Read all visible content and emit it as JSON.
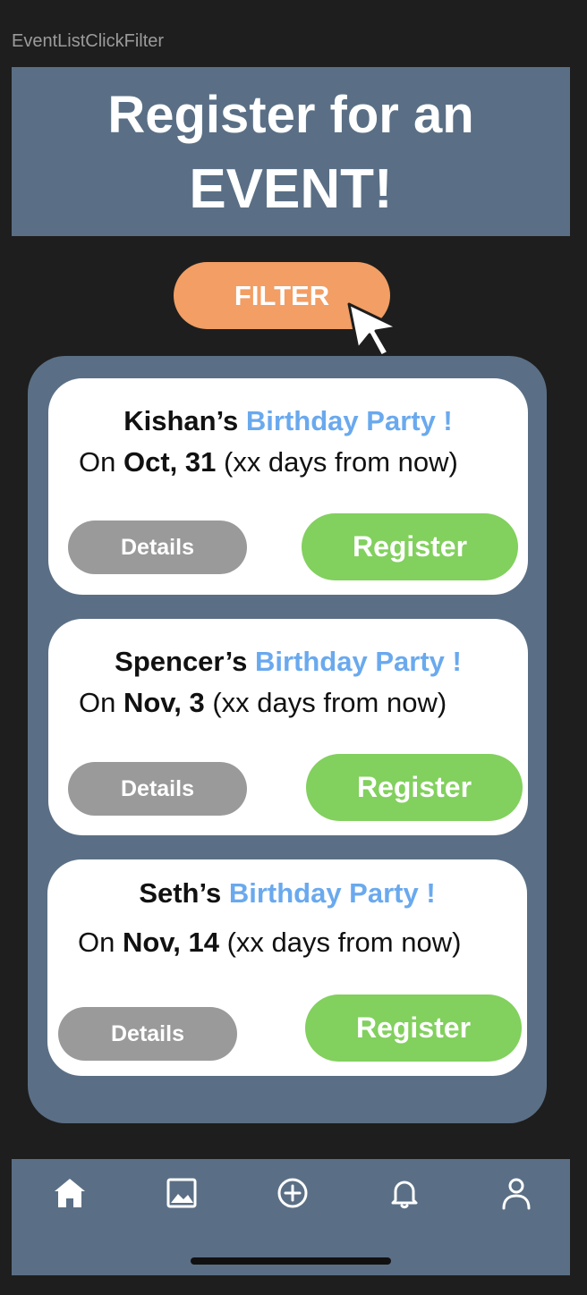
{
  "frame_label": "EventListClickFilter",
  "header": {
    "line1": "Register for an",
    "line2": "EVENT!"
  },
  "filter": {
    "label": "FILTER"
  },
  "events": [
    {
      "host": "Kishan’s",
      "accent": "Birthday Party !",
      "prefix": "On",
      "date": "Oct, 31",
      "suffix": "(xx days from now)",
      "details_label": "Details",
      "register_label": "Register"
    },
    {
      "host": "Spencer’s",
      "accent": "Birthday Party !",
      "prefix": "On",
      "date": "Nov, 3",
      "suffix": "(xx days from now)",
      "details_label": "Details",
      "register_label": "Register"
    },
    {
      "host": "Seth’s",
      "accent": "Birthday Party !",
      "prefix": "On",
      "date": "Nov, 14",
      "suffix": "(xx days from now)",
      "details_label": "Details",
      "register_label": "Register"
    }
  ],
  "nav": {
    "items": [
      {
        "icon": "home-icon"
      },
      {
        "icon": "image-icon"
      },
      {
        "icon": "plus-circle-icon"
      },
      {
        "icon": "bell-icon"
      },
      {
        "icon": "user-icon"
      }
    ]
  },
  "colors": {
    "background": "#1e1e1e",
    "panel": "#5a6f85",
    "filter": "#f29e64",
    "register": "#82d05e",
    "details": "#9a9a9a",
    "accent": "#6aa9ee"
  }
}
